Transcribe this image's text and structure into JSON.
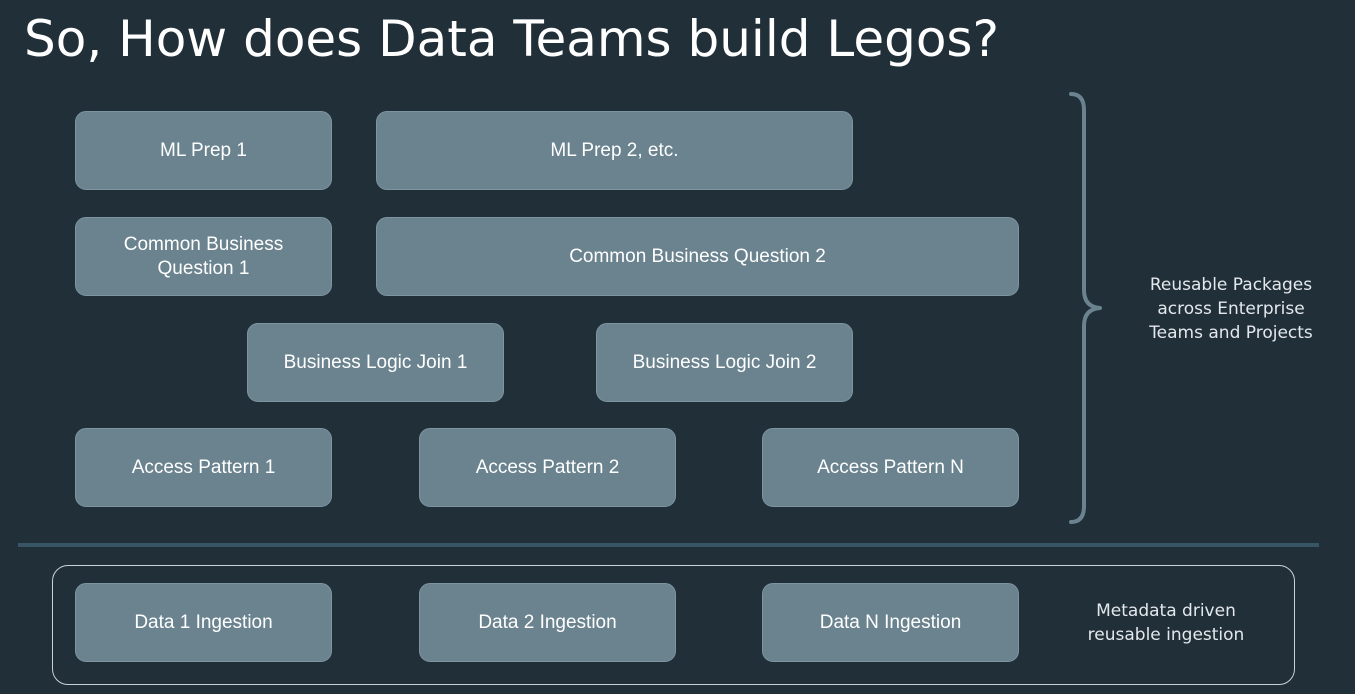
{
  "title": "So, How does Data Teams build Legos?",
  "packages": {
    "ml_prep_1": "ML Prep 1",
    "ml_prep_2": "ML Prep 2, etc.",
    "common_business_question_1": "Common Business\nQuestion 1",
    "common_business_question_2": "Common Business Question 2",
    "business_logic_join_1": "Business Logic Join 1",
    "business_logic_join_2": "Business Logic Join 2",
    "access_pattern_1": "Access Pattern 1",
    "access_pattern_2": "Access Pattern 2",
    "access_pattern_n": "Access Pattern N",
    "note": "Reusable Packages\nacross Enterprise\nTeams and Projects"
  },
  "ingestion": {
    "data_1": "Data 1 Ingestion",
    "data_2": "Data 2 Ingestion",
    "data_n": "Data N Ingestion",
    "note": "Metadata driven\nreusable ingestion"
  },
  "colors": {
    "background": "#212f39",
    "block": "#6a838f",
    "divider": "#375564",
    "brace": "#6a838f"
  }
}
